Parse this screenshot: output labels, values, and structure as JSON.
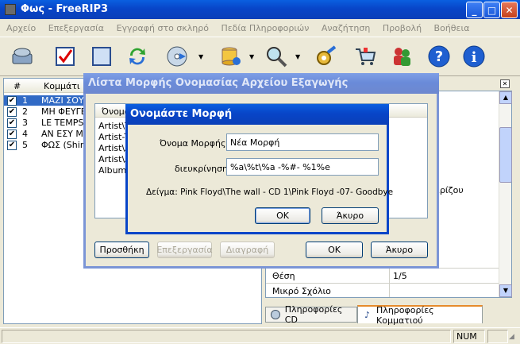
{
  "window": {
    "title": "Φως - FreeRIP3"
  },
  "menu": [
    "Αρχείο",
    "Επεξεργασία",
    "Εγγραφή στο σκληρό",
    "Πεδία Πληροφοριών",
    "Αναζήτηση",
    "Προβολή",
    "Βοήθεια"
  ],
  "tracklist": {
    "col_num": "#",
    "col_title": "Κομμάτι",
    "rows": [
      {
        "num": "1",
        "title": "ΜΑΖΙ ΣΟΥ"
      },
      {
        "num": "2",
        "title": "ΜΗ ΦΕΥΓΕΙ"
      },
      {
        "num": "3",
        "title": "LE TEMPS D"
      },
      {
        "num": "4",
        "title": "ΑΝ ΕΣΥ Μ' Α"
      },
      {
        "num": "5",
        "title": "ΦΩΣ (Shine"
      }
    ]
  },
  "right_panel": {
    "fields": [
      {
        "label": "Θέση",
        "value": "1/5"
      },
      {
        "label": "Μικρό Σχόλιο",
        "value": ""
      }
    ],
    "partial_value": "ερίζου",
    "tab_cd": "Πληροφορίες CD",
    "tab_track": "Πληροφορίες Κομματιού"
  },
  "outer_dialog": {
    "title": "Λίστα Μορφής Ονομασίας Αρχείου Εξαγωγής",
    "list_header": "Όνομα",
    "list_items": [
      "Artist\\Tr",
      "Artist-Tr",
      "Artist\\A",
      "Artist\\A",
      "Album T"
    ],
    "add_button": "Προσθήκη",
    "edit_button": "Επεξεργασία",
    "delete_button": "Διαγραφή",
    "ok_button": "OK",
    "cancel_button": "Άκυρο"
  },
  "inner_dialog": {
    "title": "Ονομάστε Μορφή",
    "name_label": "Όνομα Μορφής:",
    "name_value": "Νέα Μορφή",
    "desc_label": "διευκρίνηση",
    "desc_value": "%a\\%t\\%a -%#- %1%e",
    "example": "Δείγμα: Pink Floyd\\The wall - CD 1\\Pink Floyd -07- Goodbye",
    "ok_button": "OK",
    "cancel_button": "Άκυρο"
  },
  "status": {
    "num": "NUM"
  }
}
